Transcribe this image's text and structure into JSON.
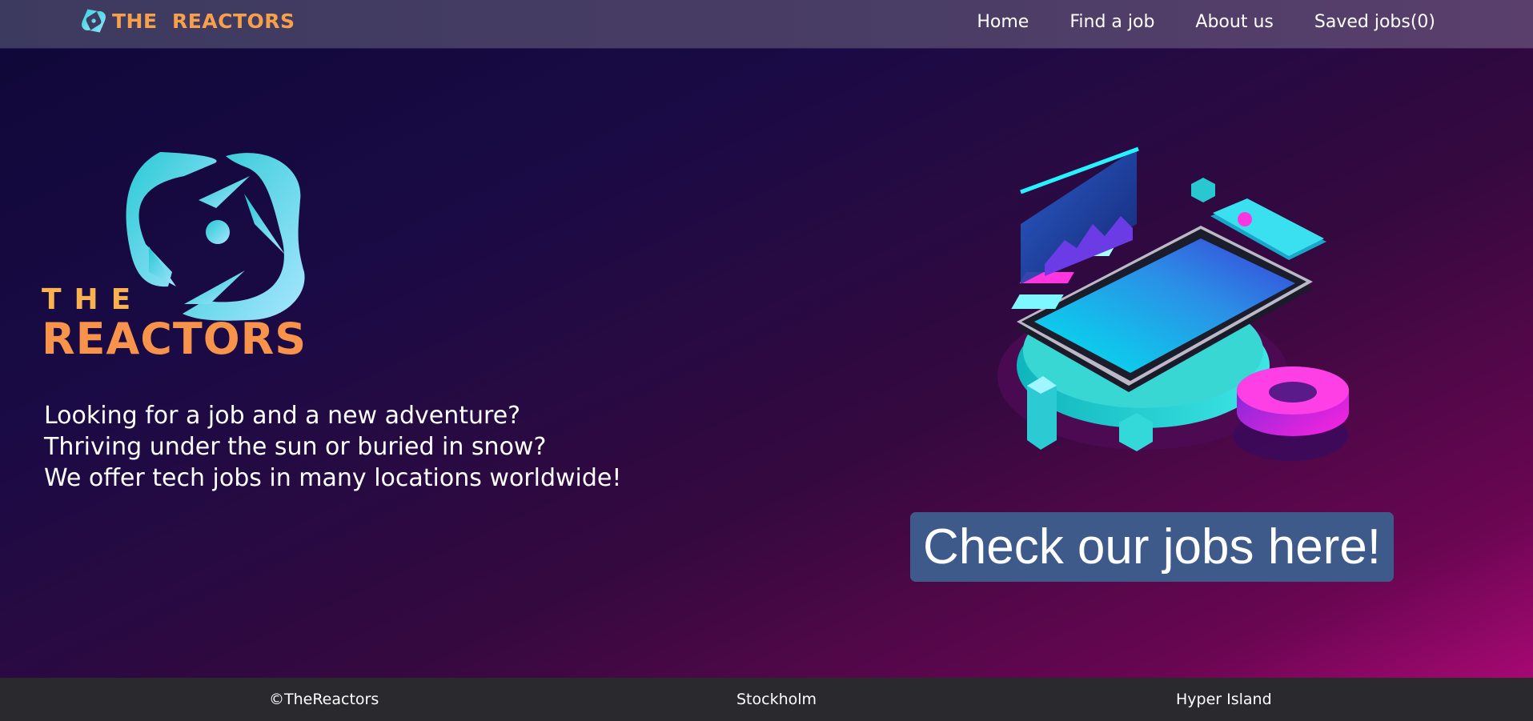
{
  "header": {
    "brand_name": "THE  REACTORS",
    "nav": [
      "Home",
      "Find a job",
      "About us",
      "Saved jobs(0)"
    ]
  },
  "hero": {
    "logo_top": "THE",
    "logo_bottom": "REACTORS",
    "tagline": [
      "Looking for a job and a new adventure?",
      "Thriving under the sun or buried in snow?",
      "We offer tech jobs in many locations worldwide!"
    ],
    "cta_label": "Check our jobs here!"
  },
  "footer": {
    "items": [
      "©TheReactors",
      "Stockholm",
      "Hyper Island"
    ]
  },
  "colors": {
    "brand_orange": "#f7934a",
    "brand_cyan": "#3ed6e0",
    "cta_bg": "#3e5a8a",
    "footer_bg": "#2a2a2e"
  }
}
